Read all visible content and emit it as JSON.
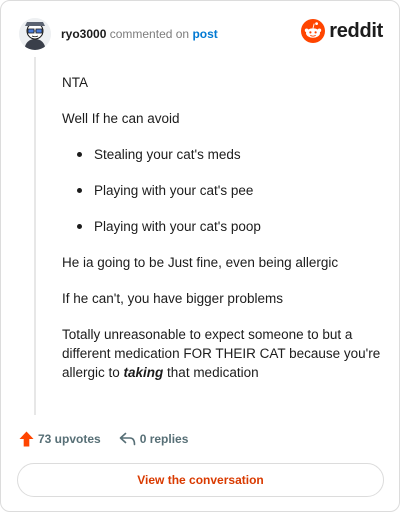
{
  "header": {
    "username": "ryo3000",
    "verb": "commented on",
    "post_link": "post",
    "brand": "reddit",
    "brand_color": "#ff4500"
  },
  "comment": {
    "p1": "NTA",
    "p2": "Well If he can avoid",
    "bullets": [
      "Stealing your cat's meds",
      "Playing with your cat's pee",
      "Playing with your cat's poop"
    ],
    "p3": "He ia going to be Just fine, even being allergic",
    "p4": "If he can't, you have bigger problems",
    "p5_before": "Totally unreasonable to expect someone to but a different medication FOR THEIR CAT because you're allergic to ",
    "p5_emphasis": "taking",
    "p5_after": " that medication"
  },
  "footer": {
    "upvotes": "73 upvotes",
    "replies": "0 replies",
    "upvote_icon": "upvote-arrow-icon",
    "reply_icon": "reply-arrow-icon",
    "upvote_color": "#ff4500"
  },
  "cta": {
    "label": "View the conversation",
    "color": "#d93a00"
  }
}
